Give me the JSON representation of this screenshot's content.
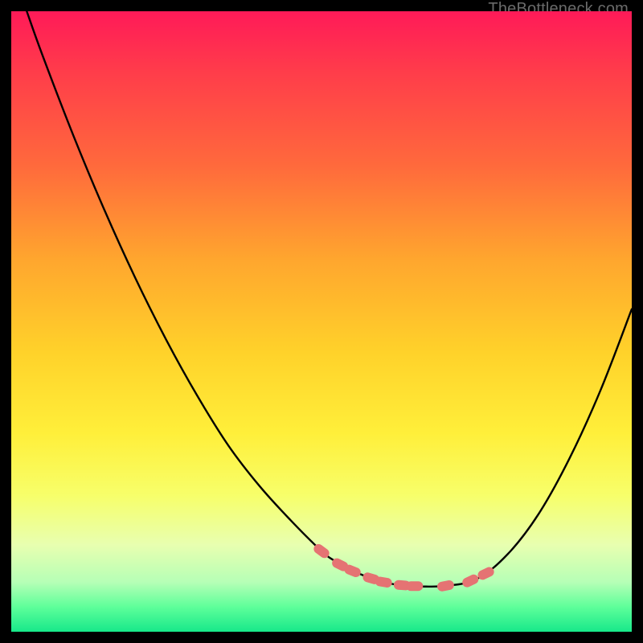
{
  "watermark": "TheBottleneck.com",
  "colors": {
    "page_bg": "#000000",
    "gradient_top": "#ff1a58",
    "gradient_bottom": "#17e88a",
    "curve": "#000000",
    "marker_fill": "#e57373",
    "marker_stroke": "#e57373"
  },
  "chart_data": {
    "type": "line",
    "title": "",
    "xlabel": "",
    "ylabel": "",
    "xlim": [
      0,
      100
    ],
    "ylim": [
      0,
      100
    ],
    "grid": false,
    "legend": false,
    "x": [
      2.5,
      5,
      10,
      15,
      20,
      25,
      30,
      35,
      40,
      45,
      50,
      52,
      54,
      56,
      58,
      60,
      62,
      64,
      66,
      70,
      75,
      80,
      85,
      90,
      95,
      100
    ],
    "values": [
      100,
      93,
      80,
      68,
      57,
      47,
      38,
      30,
      23.5,
      18,
      13,
      11.5,
      10.3,
      9.4,
      8.6,
      8,
      7.6,
      7.4,
      7.3,
      7.4,
      8.5,
      12.5,
      19,
      28,
      39,
      52
    ],
    "series": [
      {
        "name": "bottleneck-curve",
        "type": "line",
        "x": [
          2.5,
          5,
          10,
          15,
          20,
          25,
          30,
          35,
          40,
          45,
          50,
          52,
          54,
          56,
          58,
          60,
          62,
          64,
          66,
          70,
          75,
          80,
          85,
          90,
          95,
          100
        ],
        "y": [
          100,
          93,
          80,
          68,
          57,
          47,
          38,
          30,
          23.5,
          18,
          13,
          11.5,
          10.3,
          9.4,
          8.6,
          8,
          7.6,
          7.4,
          7.3,
          7.4,
          8.5,
          12.5,
          19,
          28,
          39,
          52
        ]
      },
      {
        "name": "highlighted-points",
        "type": "scatter",
        "x": [
          50,
          53,
          55,
          58,
          60,
          63,
          65,
          70,
          74,
          76.5
        ],
        "y": [
          13,
          10.8,
          9.8,
          8.6,
          8,
          7.5,
          7.35,
          7.4,
          8.2,
          9.4
        ]
      }
    ]
  }
}
